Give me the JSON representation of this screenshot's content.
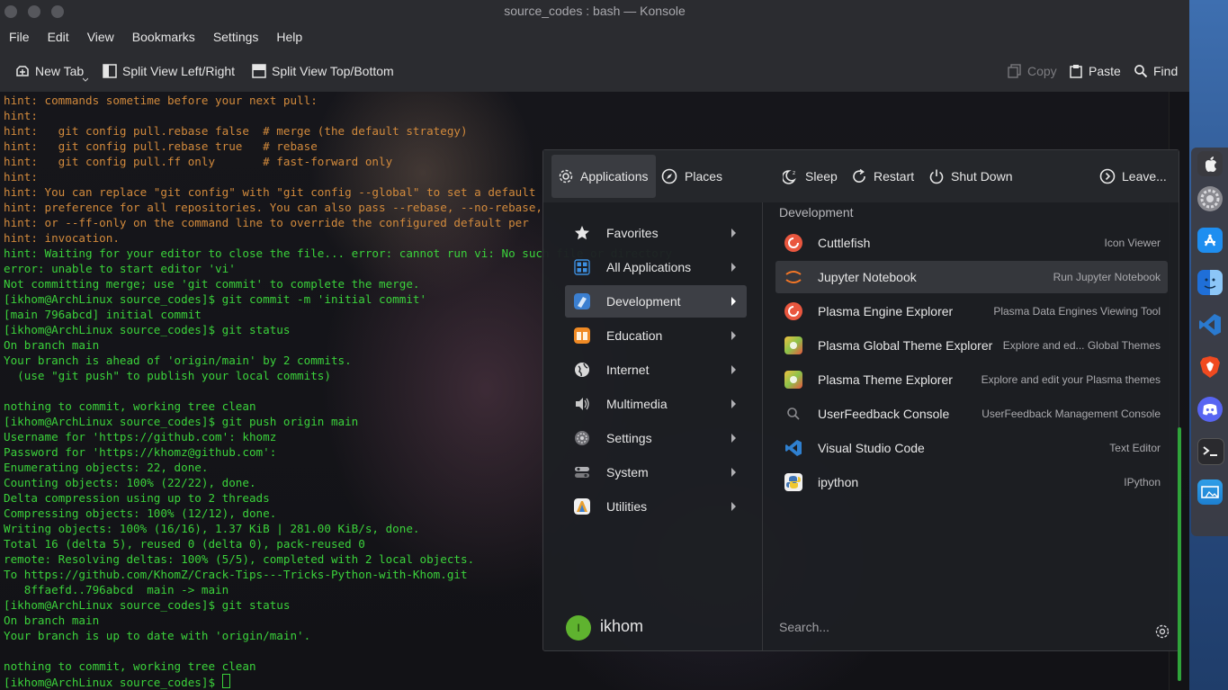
{
  "window": {
    "title": "source_codes : bash — Konsole"
  },
  "menubar": [
    "File",
    "Edit",
    "View",
    "Bookmarks",
    "Settings",
    "Help"
  ],
  "toolbar": {
    "new_tab": "New Tab",
    "split_lr": "Split View Left/Right",
    "split_tb": "Split View Top/Bottom",
    "copy": "Copy",
    "paste": "Paste",
    "find": "Find"
  },
  "terminal": {
    "lines": [
      "hint: commands sometime before your next pull:",
      "hint:",
      "hint:   git config pull.rebase false  # merge (the default strategy)",
      "hint:   git config pull.rebase true   # rebase",
      "hint:   git config pull.ff only       # fast-forward only",
      "hint:",
      "hint: You can replace \"git config\" with \"git config --global\" to set a default",
      "hint: preference for all repositories. You can also pass --rebase, --no-rebase,",
      "hint: or --ff-only on the command line to override the configured default per",
      "hint: invocation.",
      "hint: Waiting for your editor to close the file... error: cannot run vi: No such file or directory",
      "error: unable to start editor 'vi'",
      "Not committing merge; use 'git commit' to complete the merge.",
      "[ikhom@ArchLinux source_codes]$ git commit -m 'initial commit'",
      "[main 796abcd] initial commit",
      "[ikhom@ArchLinux source_codes]$ git status",
      "On branch main",
      "Your branch is ahead of 'origin/main' by 2 commits.",
      "  (use \"git push\" to publish your local commits)",
      "",
      "nothing to commit, working tree clean",
      "[ikhom@ArchLinux source_codes]$ git push origin main",
      "Username for 'https://github.com': khomz",
      "Password for 'https://khomz@github.com':",
      "Enumerating objects: 22, done.",
      "Counting objects: 100% (22/22), done.",
      "Delta compression using up to 2 threads",
      "Compressing objects: 100% (12/12), done.",
      "Writing objects: 100% (16/16), 1.37 KiB | 281.00 KiB/s, done.",
      "Total 16 (delta 5), reused 0 (delta 0), pack-reused 0",
      "remote: Resolving deltas: 100% (5/5), completed with 2 local objects.",
      "To https://github.com/KhomZ/Crack-Tips---Tricks-Python-with-Khom.git",
      "   8ffaefd..796abcd  main -> main",
      "[ikhom@ArchLinux source_codes]$ git status",
      "On branch main",
      "Your branch is up to date with 'origin/main'.",
      "",
      "nothing to commit, working tree clean",
      "[ikhom@ArchLinux source_codes]$ "
    ]
  },
  "launcher": {
    "tabs": {
      "applications": "Applications",
      "places": "Places"
    },
    "power": {
      "sleep": "Sleep",
      "restart": "Restart",
      "shutdown": "Shut Down",
      "leave": "Leave..."
    },
    "categories": [
      {
        "label": "Favorites",
        "icon": "star-icon",
        "color": "#e8e8e8"
      },
      {
        "label": "All Applications",
        "icon": "grid-icon",
        "color": "#3d8fe0"
      },
      {
        "label": "Development",
        "icon": "development-icon",
        "color": "#3b7fd0"
      },
      {
        "label": "Education",
        "icon": "education-icon",
        "color": "#f08a24"
      },
      {
        "label": "Internet",
        "icon": "globe-icon",
        "color": "#d8d8d8"
      },
      {
        "label": "Multimedia",
        "icon": "speaker-icon",
        "color": "#c8c8c8"
      },
      {
        "label": "Settings",
        "icon": "settings-icon",
        "color": "#9a9a9e"
      },
      {
        "label": "System",
        "icon": "system-icon",
        "color": "#b0b0b4"
      },
      {
        "label": "Utilities",
        "icon": "utilities-icon",
        "color": "#e8a030"
      }
    ],
    "section_title": "Development",
    "apps": [
      {
        "name": "Cuttlefish",
        "desc": "Icon Viewer",
        "icon": "cuttlefish-icon",
        "color": "#e9573f"
      },
      {
        "name": "Jupyter Notebook",
        "desc": "Run Jupyter Notebook",
        "icon": "jupyter-icon",
        "color": "#f37626"
      },
      {
        "name": "Plasma Engine Explorer",
        "desc": "Plasma Data Engines Viewing Tool",
        "icon": "plasma-engine-icon",
        "color": "#e9573f"
      },
      {
        "name": "Plasma Global Theme Explorer",
        "desc": "Explore and ed... Global Themes",
        "icon": "plasma-theme-icon",
        "color": "#8bc34a"
      },
      {
        "name": "Plasma Theme Explorer",
        "desc": "Explore and edit your Plasma themes",
        "icon": "plasma-theme-icon",
        "color": "#8bc34a"
      },
      {
        "name": "UserFeedback Console",
        "desc": "UserFeedback Management Console",
        "icon": "search-icon",
        "color": "#2f3034"
      },
      {
        "name": "Visual Studio Code",
        "desc": "Text Editor",
        "icon": "vscode-icon",
        "color": "#2f80d0"
      },
      {
        "name": "ipython",
        "desc": "IPython",
        "icon": "python-icon",
        "color": "#f0f0f0"
      }
    ],
    "user": {
      "name": "ikhom",
      "initial": "I"
    },
    "search_placeholder": "Search..."
  },
  "dock": [
    {
      "name": "apple-icon",
      "color": "#3a3a3f"
    },
    {
      "name": "system-preferences-icon",
      "color": "#8a8a90"
    },
    {
      "name": "app-store-icon",
      "color": "#1e8ef0"
    },
    {
      "name": "finder-icon",
      "color": "#3f97f0"
    },
    {
      "name": "vscode-icon",
      "color": "#2a7ad0"
    },
    {
      "name": "brave-icon",
      "color": "#f04a20"
    },
    {
      "name": "discord-icon",
      "color": "#5865f2"
    },
    {
      "name": "terminal-icon",
      "color": "#2a2a2e"
    },
    {
      "name": "screenshot-icon",
      "color": "#2f9ee8"
    }
  ]
}
